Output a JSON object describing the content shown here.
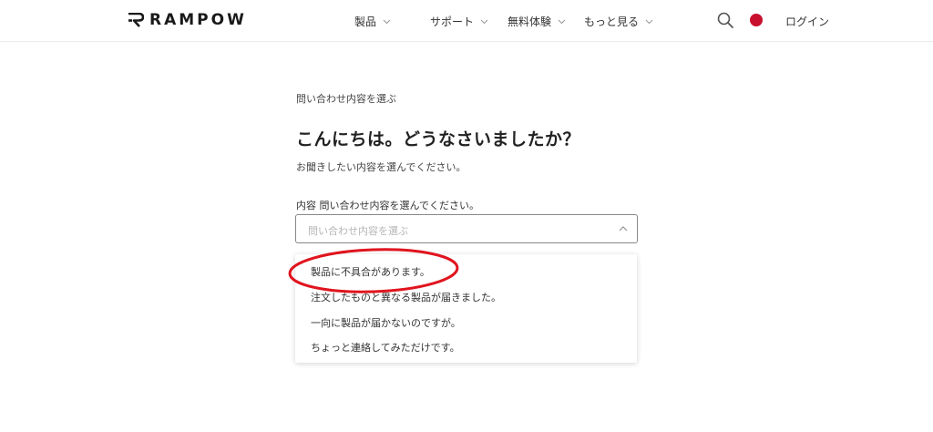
{
  "header": {
    "logo_text": "RAMPOW",
    "nav": [
      {
        "label": "製品"
      },
      {
        "label": "サポート"
      },
      {
        "label": "無料体験"
      },
      {
        "label": "もっと見る"
      }
    ],
    "login_label": "ログイン",
    "flag_color": "#c8102e"
  },
  "main": {
    "breadcrumb": "問い合わせ内容を選ぶ",
    "title": "こんにちは。どうなさいましたか？",
    "subtitle": "お聞きしたい内容を選んでください。",
    "field_label": "内容 問い合わせ内容を選んでください。",
    "select_placeholder": "問い合わせ内容を選ぶ",
    "options": [
      "製品に不具合があります。",
      "注文したものと異なる製品が届きました。",
      "一向に製品が届かないのですが。",
      "ちょっと連絡してみただけです。"
    ]
  },
  "annotation": {
    "highlight_color": "#e0141e"
  }
}
